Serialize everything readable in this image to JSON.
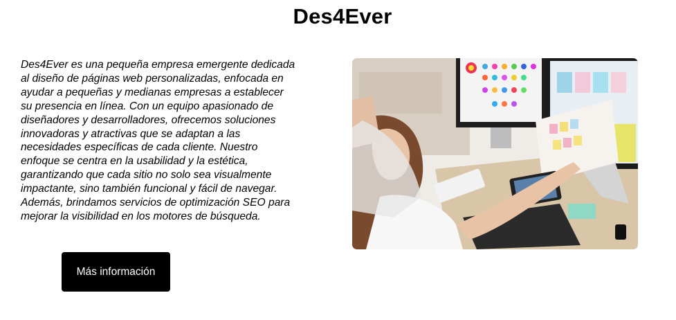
{
  "header": {
    "title": "Des4Ever"
  },
  "about": {
    "description": "Des4Ever es una pequeña empresa emergente dedicada al diseño de páginas web personalizadas, enfocada en ayudar a pequeñas y medianas empresas a establecer su presencia en línea. Con un equipo apasionado de diseñadores y desarrolladores, ofrecemos soluciones innovadoras y atractivas que se adaptan a las necesidades específicas de cada cliente. Nuestro enfoque se centra en la usabilidad y la estética, garantizando que cada sitio no solo sea visualmente impactante, sino también funcional y fácil de navegar. Además, brindamos servicios de optimización SEO para mejorar la visibilidad en los motores de búsqueda.",
    "button_label": "Más información"
  },
  "colors": {
    "button_bg": "#000000",
    "button_text": "#ffffff",
    "background": "#ffffff"
  }
}
